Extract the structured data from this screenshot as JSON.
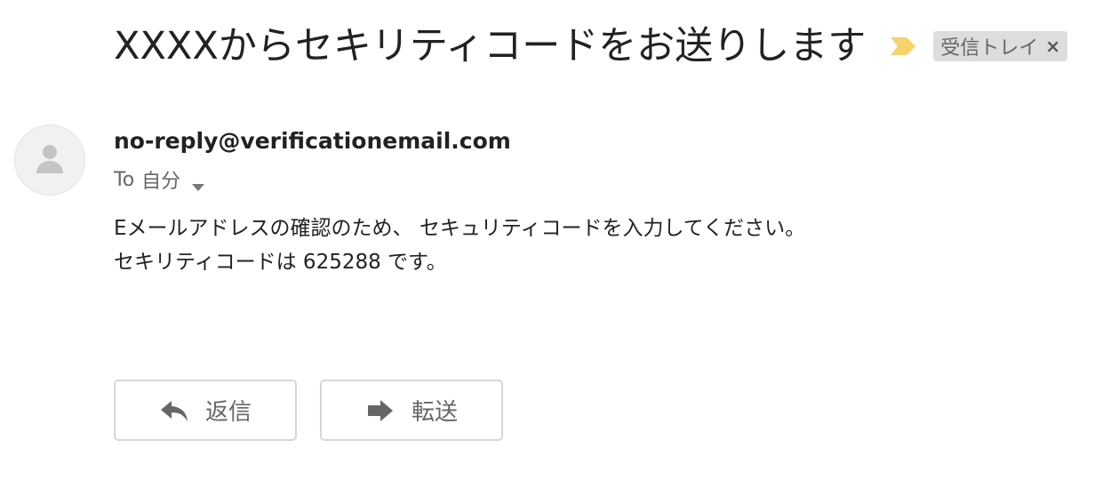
{
  "email": {
    "subject": "XXXXからセキリティコードをお送りします",
    "label": "受信トレイ",
    "label_remove": "×",
    "sender": "no-reply@verificationemail.com",
    "to_prefix": "To",
    "to_value": "自分",
    "body_lines": [
      "Eメールアドレスの確認のため、 セキュリティコードを入力してください。",
      "セキリティコードは 625288 です。"
    ]
  },
  "actions": {
    "reply_label": "返信",
    "forward_label": "転送"
  },
  "icons": {
    "importance": "importance-marker-icon",
    "avatar": "person-avatar-icon",
    "caret": "caret-down-icon",
    "reply": "reply-arrow-icon",
    "forward": "forward-arrow-icon"
  },
  "colors": {
    "importance": "#F7D36B",
    "label_chip_bg": "#DDDDDD",
    "button_border": "#D6D6D6",
    "text_muted": "#666666"
  }
}
